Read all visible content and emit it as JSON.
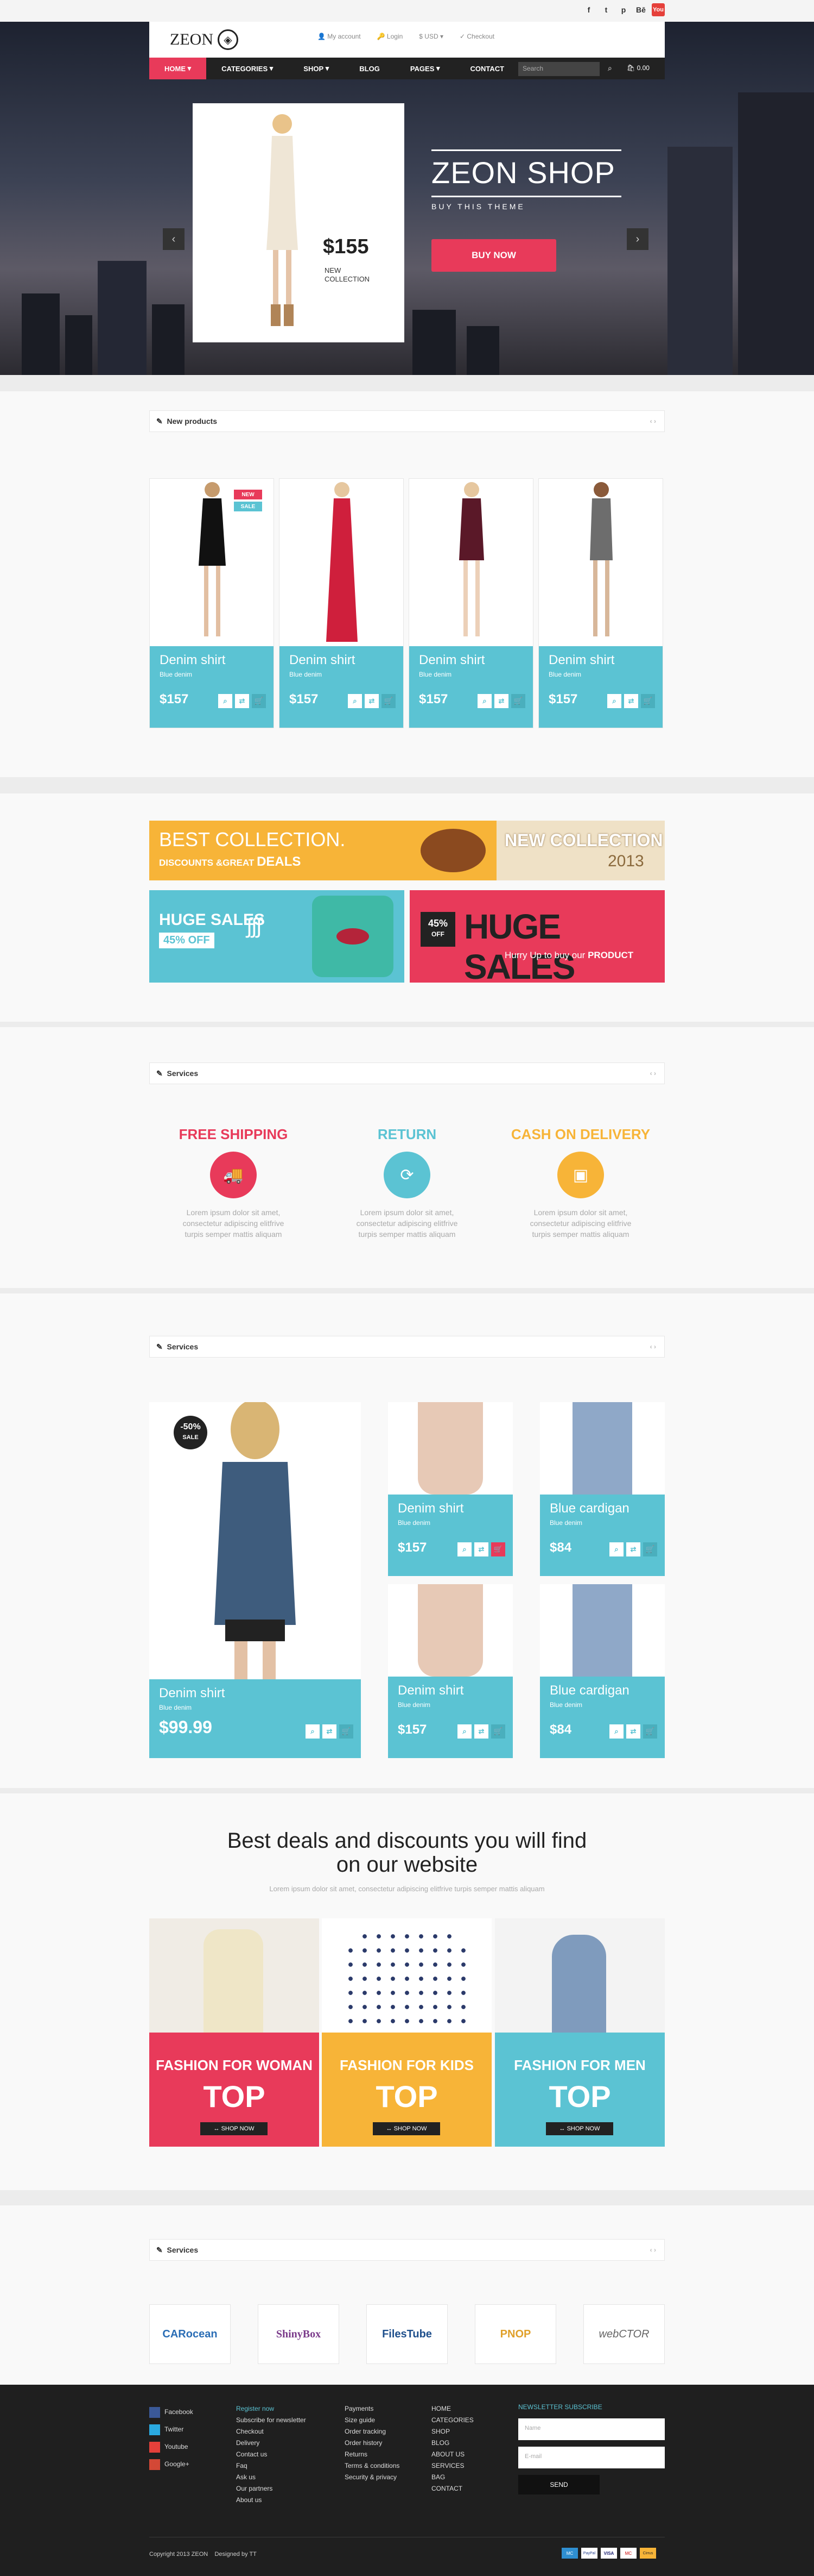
{
  "header": {
    "logo": "ZEON",
    "util": [
      "My account",
      "Login",
      "$ USD",
      "Checkout"
    ],
    "social": [
      "f",
      "t",
      "p",
      "Bē",
      "You"
    ]
  },
  "nav": {
    "items": [
      "HOME",
      "CATEGORIES",
      "SHOP",
      "BLOG",
      "PAGES",
      "CONTACT"
    ],
    "search_placeholder": "Search",
    "cart": "0.00"
  },
  "hero": {
    "price": "$155",
    "new_collection": "NEW COLLECTION",
    "title": "ZEON SHOP",
    "subtitle": "BUY THIS THEME",
    "button": "BUY NOW"
  },
  "new_products": {
    "title": "New products",
    "badges": [
      "NEW",
      "SALE"
    ],
    "items": [
      {
        "name": "Denim shirt",
        "sub": "Blue denim",
        "price": "$157"
      },
      {
        "name": "Denim shirt",
        "sub": "Blue denim",
        "price": "$157"
      },
      {
        "name": "Denim shirt",
        "sub": "Blue denim",
        "price": "$157"
      },
      {
        "name": "Denim shirt",
        "sub": "Blue denim",
        "price": "$157"
      }
    ]
  },
  "banners": {
    "b1_left": "BEST COLLECTION.",
    "b1_left2": "DISCOUNTS &GREAT",
    "b1_left3": "DEALS",
    "b1_right": "NEW COLLECTION",
    "b1_year": "2013",
    "b2_title": "HUGE SALES",
    "b2_off": "45% OFF",
    "b3_pct": "45%",
    "b3_off": "OFF",
    "b3_title": "HUGE SALES",
    "b3_sub": "Hurry Up to buy our",
    "b3_prod": "PRODUCT"
  },
  "services": {
    "title": "Services",
    "items": [
      {
        "title": "FREE SHIPPING",
        "color": "#e83a5a",
        "desc": "Lorem ipsum dolor sit amet, consectetur adipiscing elitfrive turpis semper mattis aliquam"
      },
      {
        "title": "RETURN",
        "color": "#5bc3d3",
        "desc": "Lorem ipsum dolor sit amet, consectetur adipiscing elitfrive turpis semper mattis aliquam"
      },
      {
        "title": "CASH ON DELIVERY",
        "color": "#f7b438",
        "desc": "Lorem ipsum dolor sit amet, consectetur adipiscing elitfrive turpis semper mattis aliquam"
      }
    ]
  },
  "featured": {
    "title": "Services",
    "sale_pct": "-50%",
    "sale_word": "SALE",
    "big": {
      "name": "Denim shirt",
      "sub": "Blue denim",
      "price": "$99.99"
    },
    "items": [
      {
        "name": "Denim shirt",
        "sub": "Blue denim",
        "price": "$157"
      },
      {
        "name": "Blue cardigan",
        "sub": "Blue denim",
        "price": "$84"
      },
      {
        "name": "Denim shirt",
        "sub": "Blue denim",
        "price": "$157"
      },
      {
        "name": "Blue cardigan",
        "sub": "Blue denim",
        "price": "$84"
      }
    ]
  },
  "deals": {
    "title1": "Best deals and discounts you will find",
    "title2": "on our website",
    "sub": "Lorem ipsum dolor sit amet, consectetur adipiscing elitfrive turpis semper mattis aliquam",
    "items": [
      {
        "title": "FASHION FOR WOMAN",
        "top": "TOP",
        "btn": "SHOP NOW",
        "color": "#e83a5a"
      },
      {
        "title": "FASHION FOR KIDS",
        "top": "TOP",
        "btn": "SHOP NOW",
        "color": "#f7b438"
      },
      {
        "title": "FASHION FOR MEN",
        "top": "TOP",
        "btn": "SHOP NOW",
        "color": "#5bc3d3"
      }
    ]
  },
  "brands": {
    "title": "Services",
    "items": [
      "CARocean",
      "ShinyBox",
      "FilesTube",
      "PNOP",
      "webCTOR"
    ]
  },
  "footer": {
    "social": [
      "Facebook",
      "Twitter",
      "Youtube",
      "Google+"
    ],
    "col1": [
      "Register now",
      "Subscribe for newsletter",
      "Checkout",
      "Delivery",
      "Contact us",
      "Faq",
      "Ask us",
      "Our partners",
      "About us"
    ],
    "col2": [
      "Payments",
      "Size guide",
      "Order tracking",
      "Order history",
      "Returns",
      "Terms & conditions",
      "Security & privacy"
    ],
    "col3": [
      "HOME",
      "CATEGORIES",
      "SHOP",
      "BLOG",
      "ABOUT US",
      "SERVICES",
      "BAG",
      "CONTACT"
    ],
    "newsletter_title": "NEWSLETTER SUBSCRIBE",
    "name_ph": "Name",
    "email_ph": "E-mail",
    "send": "SEND",
    "copyright": "Copyright 2013 ZEON",
    "designed": "Designed by TT",
    "payments": [
      "MC",
      "PayPal",
      "VISA",
      "MC",
      "Cirrus"
    ]
  }
}
